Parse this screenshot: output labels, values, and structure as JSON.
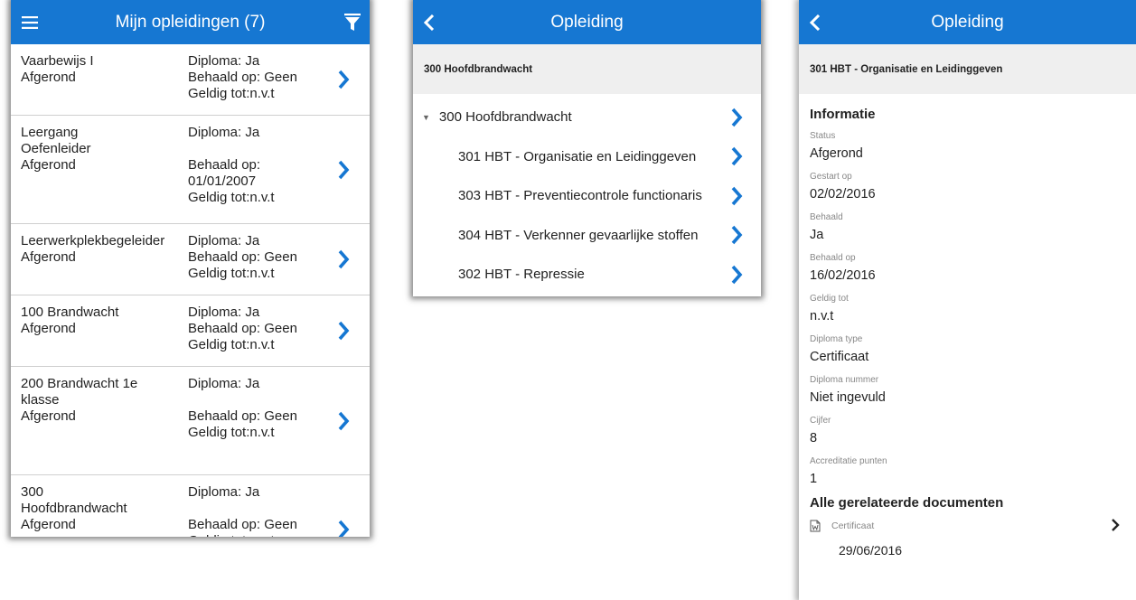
{
  "list_screen": {
    "title": "Mijn opleidingen (7)",
    "items": [
      {
        "name": "Vaarbewijs I\nAfgerond",
        "diploma": "Diploma: Ja",
        "behaald": "Behaald op: Geen",
        "geldig": "Geldig tot:n.v.t"
      },
      {
        "name": "Leergang\nOefenleider\nAfgerond",
        "diploma": "Diploma: Ja",
        "behaald": "Behaald op:\n01/01/2007",
        "geldig": "Geldig tot:n.v.t"
      },
      {
        "name": "Leerwerkplekbegeleider\nAfgerond",
        "diploma": "Diploma: Ja",
        "behaald": "Behaald op: Geen",
        "geldig": "Geldig tot:n.v.t"
      },
      {
        "name": "100 Brandwacht\nAfgerond",
        "diploma": "Diploma: Ja",
        "behaald": "Behaald op: Geen",
        "geldig": "Geldig tot:n.v.t"
      },
      {
        "name": "200 Brandwacht 1e\nklasse\nAfgerond",
        "diploma": "Diploma: Ja",
        "behaald": "Behaald op: Geen",
        "geldig": "Geldig tot:n.v.t"
      },
      {
        "name": "300\nHoofdbrandwacht\nAfgerond",
        "diploma": "Diploma: Ja",
        "behaald": "Behaald op: Geen",
        "geldig": "Geldig tot:n.v.t"
      }
    ]
  },
  "tree_screen": {
    "title": "Opleiding",
    "subheader": "300 Hoofdbrandwacht",
    "root": "300 Hoofdbrandwacht",
    "children": [
      "301 HBT - Organisatie en Leidinggeven",
      "303 HBT - Preventiecontrole functionaris",
      "304 HBT - Verkenner gevaarlijke stoffen",
      "302 HBT - Repressie"
    ]
  },
  "detail_screen": {
    "title": "Opleiding",
    "subheader": "301 HBT - Organisatie en Leidinggeven",
    "info_title": "Informatie",
    "fields": [
      {
        "label": "Status",
        "value": "Afgerond"
      },
      {
        "label": "Gestart op",
        "value": "02/02/2016"
      },
      {
        "label": "Behaald",
        "value": "Ja"
      },
      {
        "label": "Behaald op",
        "value": "16/02/2016"
      },
      {
        "label": "Geldig tot",
        "value": "n.v.t"
      },
      {
        "label": "Diploma type",
        "value": "Certificaat"
      },
      {
        "label": "Diploma nummer",
        "value": "Niet ingevuld"
      },
      {
        "label": "Cijfer",
        "value": "8"
      },
      {
        "label": "Accreditatie punten",
        "value": "1"
      }
    ],
    "docs_title": "Alle gerelateerde documenten",
    "document": {
      "name": "Certificaat",
      "date": "29/06/2016"
    }
  },
  "colors": {
    "accent": "#1677d2",
    "subheader_bg": "#efefef"
  },
  "icons": {
    "menu": "menu-icon",
    "filter": "filter-icon",
    "back": "back-chevron-icon",
    "chevron": "chevron-right-icon",
    "document": "document-word-icon"
  }
}
